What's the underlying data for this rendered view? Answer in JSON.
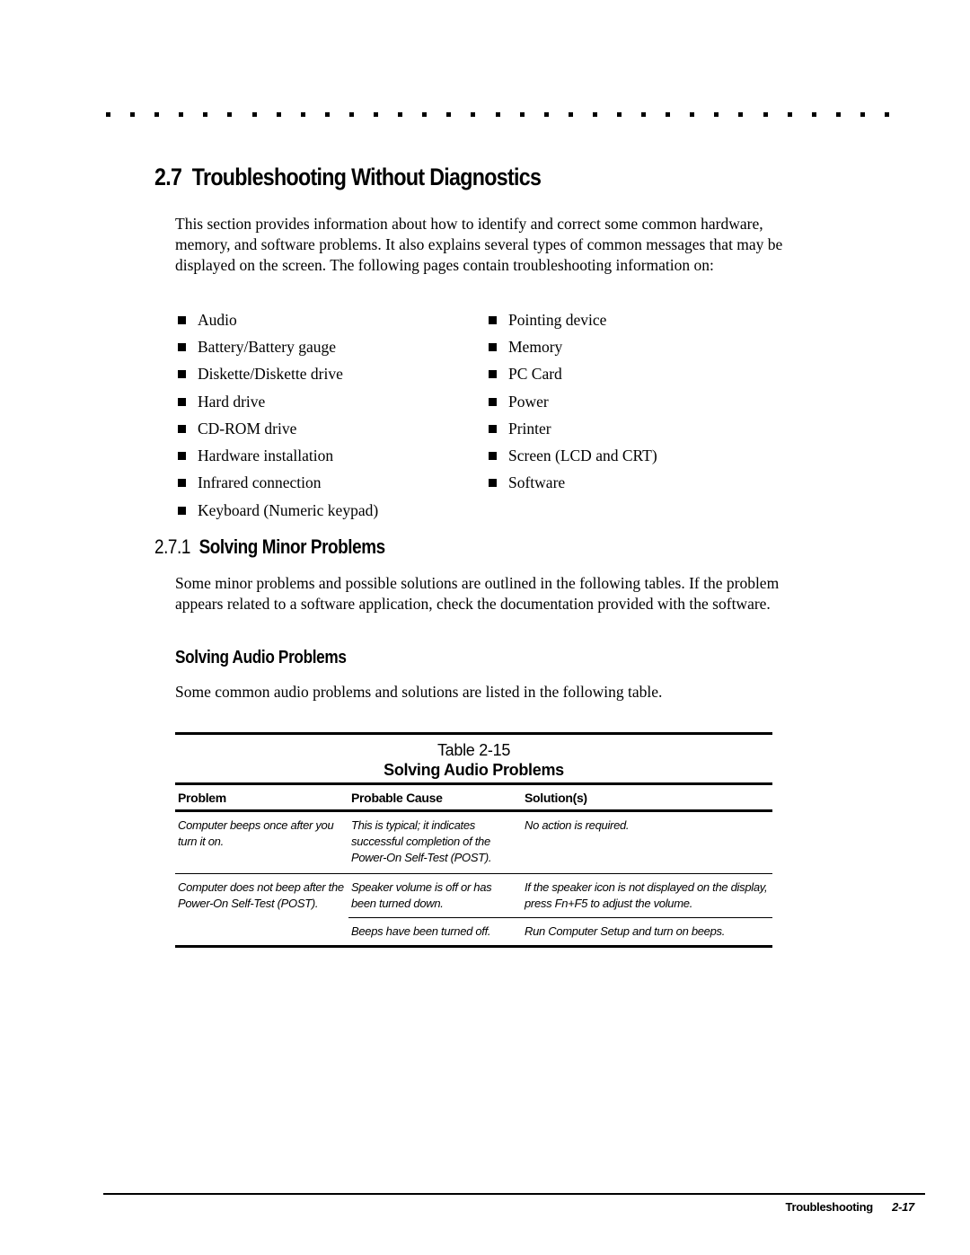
{
  "header": {
    "dot_count": 33
  },
  "section": {
    "number": "2.7",
    "title": "Troubleshooting Without Diagnostics",
    "intro": "This section provides information about how to identify and correct some common hardware, memory, and software problems. It also explains several types of common messages that may be displayed on the screen. The following pages contain troubleshooting information on:",
    "topics_left": [
      "Audio",
      "Battery/Battery gauge",
      "Diskette/Diskette drive",
      "Hard drive",
      "CD-ROM drive",
      "Hardware installation",
      "Infrared connection",
      "Keyboard (Numeric keypad)"
    ],
    "topics_right": [
      "Pointing device",
      "Memory",
      "PC Card",
      "Power",
      "Printer",
      "Screen (LCD and CRT)",
      "Software"
    ]
  },
  "subsection": {
    "number": "2.7.1",
    "title": "Solving Minor Problems",
    "body": "Some minor problems and possible solutions are outlined in the following tables. If the problem appears related to a software application, check the documentation provided with the software."
  },
  "audio": {
    "heading": "Solving Audio Problems",
    "body": "Some common audio problems and solutions are listed in the following table."
  },
  "table": {
    "label": "Table 2-15",
    "title": "Solving Audio Problems",
    "headers": [
      "Problem",
      "Probable Cause",
      "Solution(s)"
    ],
    "rows": [
      {
        "problem": "Computer beeps once after you turn it on.",
        "causes": [
          {
            "cause": "This is typical; it indicates successful completion of the Power-On Self-Test (POST).",
            "solution": "No action is required."
          }
        ]
      },
      {
        "problem": "Computer does not beep after the Power-On Self-Test (POST).",
        "causes": [
          {
            "cause": "Speaker volume is off or has been turned down.",
            "solution": "If the speaker icon is not displayed on the display, press Fn+F5 to adjust the volume."
          },
          {
            "cause": "Beeps have been turned off.",
            "solution": "Run Computer Setup and turn on beeps."
          }
        ]
      }
    ]
  },
  "footer": {
    "chapter": "Troubleshooting",
    "page": "2-17"
  }
}
